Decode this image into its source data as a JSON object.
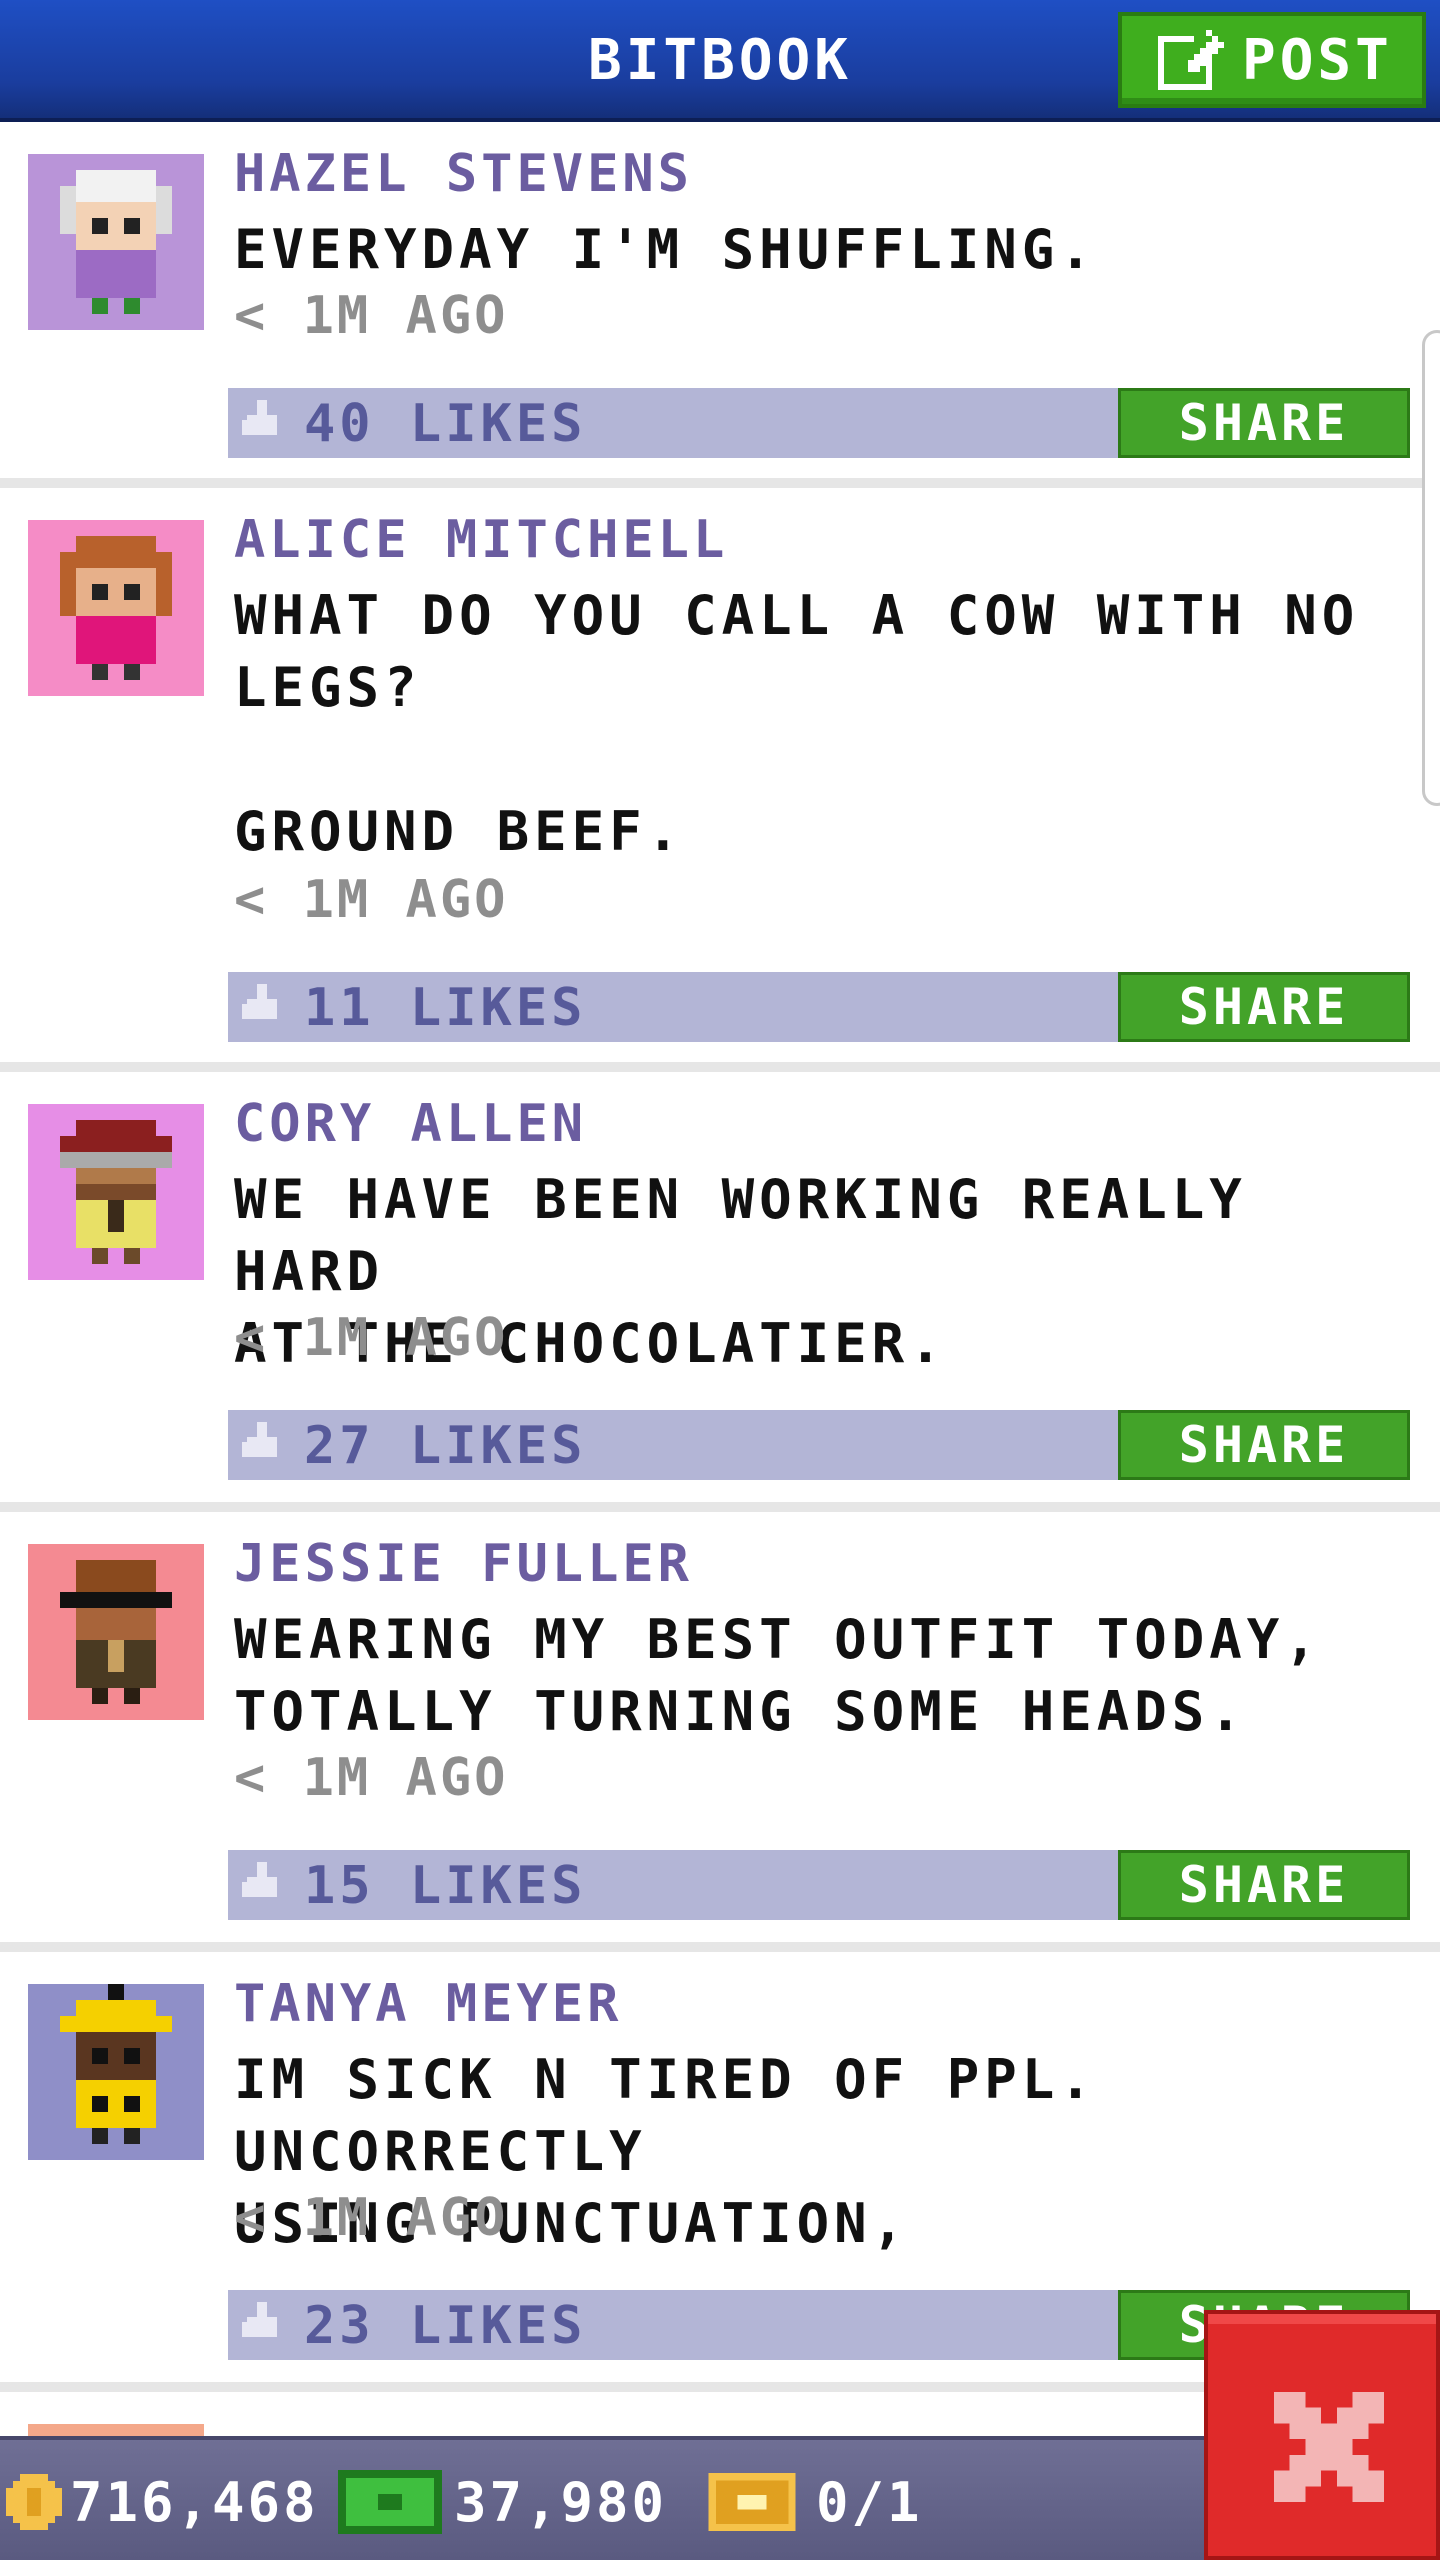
{
  "header": {
    "title": "BITBOOK",
    "post_label": "POST"
  },
  "feed": {
    "posts": [
      {
        "author": "HAZEL STEVENS",
        "text": "EVERYDAY I'M SHUFFLING.",
        "time": "< 1M AGO",
        "likes": "40 LIKES",
        "share": "SHARE",
        "avatar_bg": "#b994d8"
      },
      {
        "author": "ALICE MITCHELL",
        "text": "WHAT DO YOU CALL A COW WITH NO\nLEGS?\n\nGROUND BEEF.",
        "time": "< 1M AGO",
        "likes": "11 LIKES",
        "share": "SHARE",
        "avatar_bg": "#f58cc6"
      },
      {
        "author": "CORY ALLEN",
        "text": "WE HAVE BEEN WORKING REALLY HARD\nAT THE CHOCOLATIER.",
        "time": "< 1M AGO",
        "likes": "27 LIKES",
        "share": "SHARE",
        "avatar_bg": "#e68ee6"
      },
      {
        "author": "JESSIE FULLER",
        "text": "WEARING MY BEST OUTFIT TODAY,\nTOTALLY TURNING SOME HEADS.",
        "time": "< 1M AGO",
        "likes": "15 LIKES",
        "share": "SHARE",
        "avatar_bg": "#f48a92"
      },
      {
        "author": "TANYA MEYER",
        "text": "IM SICK N TIRED OF PPL. UNCORRECTLY\nUSING PUNCTUATION,",
        "time": "< 1M AGO",
        "likes": "23 LIKES",
        "share": "SHARE",
        "avatar_bg": "#8f8fc8"
      }
    ]
  },
  "bottom_bar": {
    "coins": "716,468",
    "bux": "37,980",
    "tickets": "0/1"
  },
  "icons": {
    "post": "edit-icon",
    "like": "thumbs-up-icon",
    "coin": "coin-icon",
    "bux": "bux-icon",
    "ticket": "ticket-icon",
    "close": "close-icon"
  },
  "colors": {
    "header": "#1a3d9e",
    "accent_green": "#43a329",
    "like_bar": "#b3b5d6",
    "author": "#6b5da0",
    "close": "#e02a2a"
  }
}
